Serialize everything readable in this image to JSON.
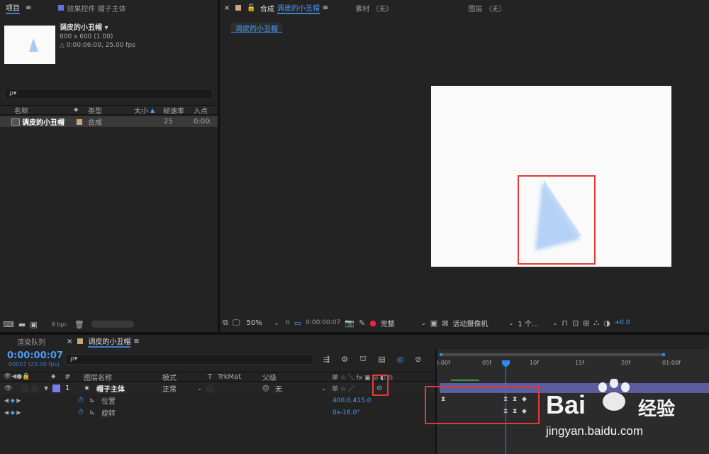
{
  "project_panel": {
    "tabs": [
      "项目",
      "效果控件 帽子主体"
    ],
    "comp_name": "调皮的小丑帽 ▾",
    "comp_size": "800 x 600 (1.00)",
    "comp_duration": "△ 0:00:06:00, 25.00 fps",
    "search_placeholder": "ρ▾",
    "columns": [
      "名称",
      "类型",
      "大小",
      "帧速率",
      "入点"
    ],
    "items": [
      {
        "name": "调皮的小丑帽",
        "type": "合成",
        "fps": "25",
        "in": "0:00"
      }
    ],
    "bpc": "8 bpc"
  },
  "comp_panel": {
    "tab_label": "合成",
    "tab_name": "调皮的小丑帽",
    "footage_tab": "素材 （无）",
    "layer_tab": "图层 （无）",
    "breadcrumb": "调皮的小丑帽",
    "zoom": "50%",
    "timecode": "0:00:00:07",
    "resolution": "完整",
    "camera": "活动摄像机",
    "views": "1 个...",
    "exposure": "+0.0"
  },
  "timeline": {
    "tabs": [
      "渲染队列",
      "调皮的小丑帽"
    ],
    "timecode": "0:00:00:07",
    "frames_info": "00007 (25.00 fps)",
    "search_placeholder": "ρ▾",
    "col_hash": "#",
    "col_layer_name": "图层名称",
    "col_mode": "模式",
    "col_t": "T",
    "col_trkmat": "TrkMat",
    "col_parent": "父级",
    "col_switches": "单 ☆ ＼ fx ▣ ◎ ◐ ⊙",
    "layer": {
      "num": "1",
      "name": "帽子主体",
      "mode": "正常",
      "parent": "无"
    },
    "props": [
      {
        "name": "位置",
        "value": "400.0,415.0"
      },
      {
        "name": "旋转",
        "value": "0x-16.0°"
      }
    ],
    "ruler": [
      "):00f",
      "05f",
      "10f",
      "15f",
      "20f",
      "01:00f"
    ]
  },
  "watermark": {
    "brand": "Bai",
    "brand2": "经验",
    "url": "jingyan.baidu.com"
  },
  "colors": {
    "accent": "#3d7fd1",
    "timecode": "#4a9cf5",
    "label_purple": "#7a7df0",
    "highlight": "#e23a3a"
  }
}
